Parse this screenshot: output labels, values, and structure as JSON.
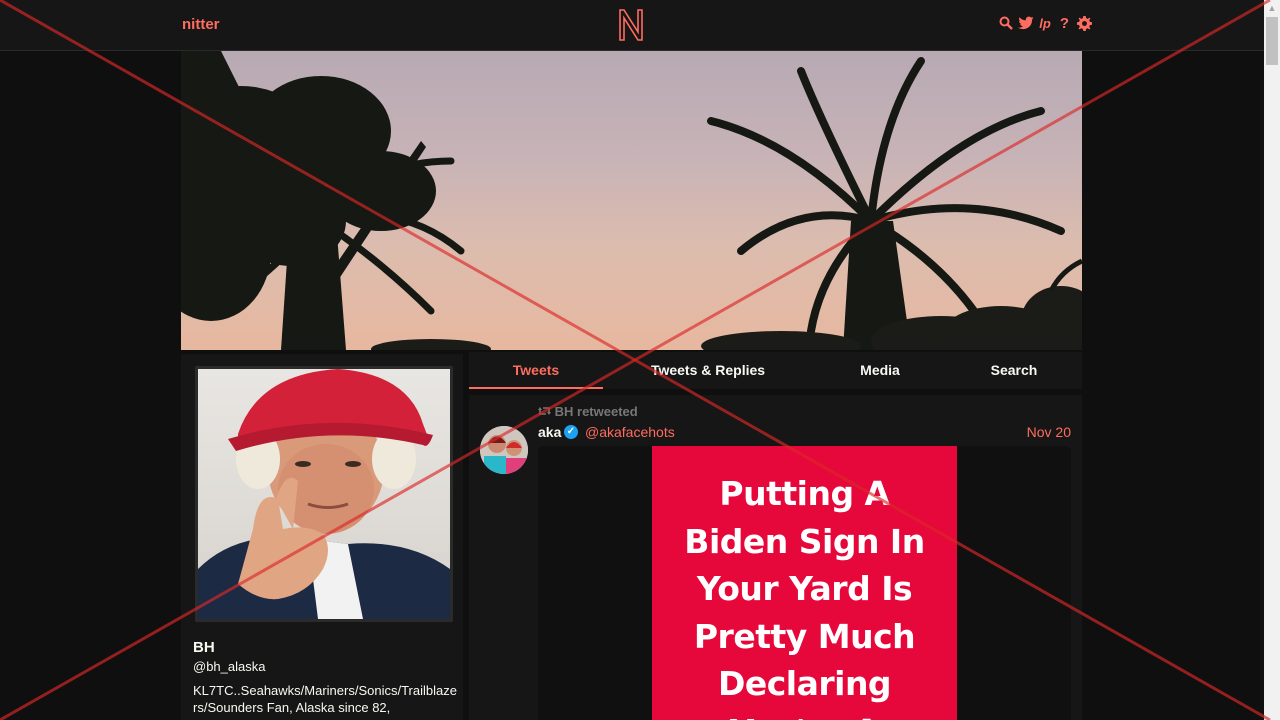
{
  "navbar": {
    "brand": "nitter",
    "logo_letter": "N",
    "icons": [
      "search-icon",
      "twitter-bird-icon",
      "lp-icon",
      "help-icon",
      "settings-gear-icon"
    ]
  },
  "profile": {
    "fullname": "BH",
    "username": "@bh_alaska",
    "bio": "KL7TC..Seahawks/Mariners/Sonics/Trailblazers/Sounders Fan, Alaska since 82,"
  },
  "tabs": [
    {
      "label": "Tweets",
      "active": true
    },
    {
      "label": "Tweets & Replies",
      "active": false
    },
    {
      "label": "Media",
      "active": false
    },
    {
      "label": "Search",
      "active": false
    }
  ],
  "tweet": {
    "retweet_header": "BH retweeted",
    "fullname": "aka",
    "verified": true,
    "handle": "@akafacehots",
    "date": "Nov 20",
    "media_text_lines": [
      "Putting A",
      "Biden Sign In",
      "Your Yard Is",
      "Pretty Much",
      "Declaring",
      "You're A"
    ]
  },
  "colors": {
    "accent": "#ff6c60",
    "background": "#0f0f0f",
    "panel": "#161616",
    "media_red": "#e6083b",
    "verified_blue": "#1da1f2"
  }
}
